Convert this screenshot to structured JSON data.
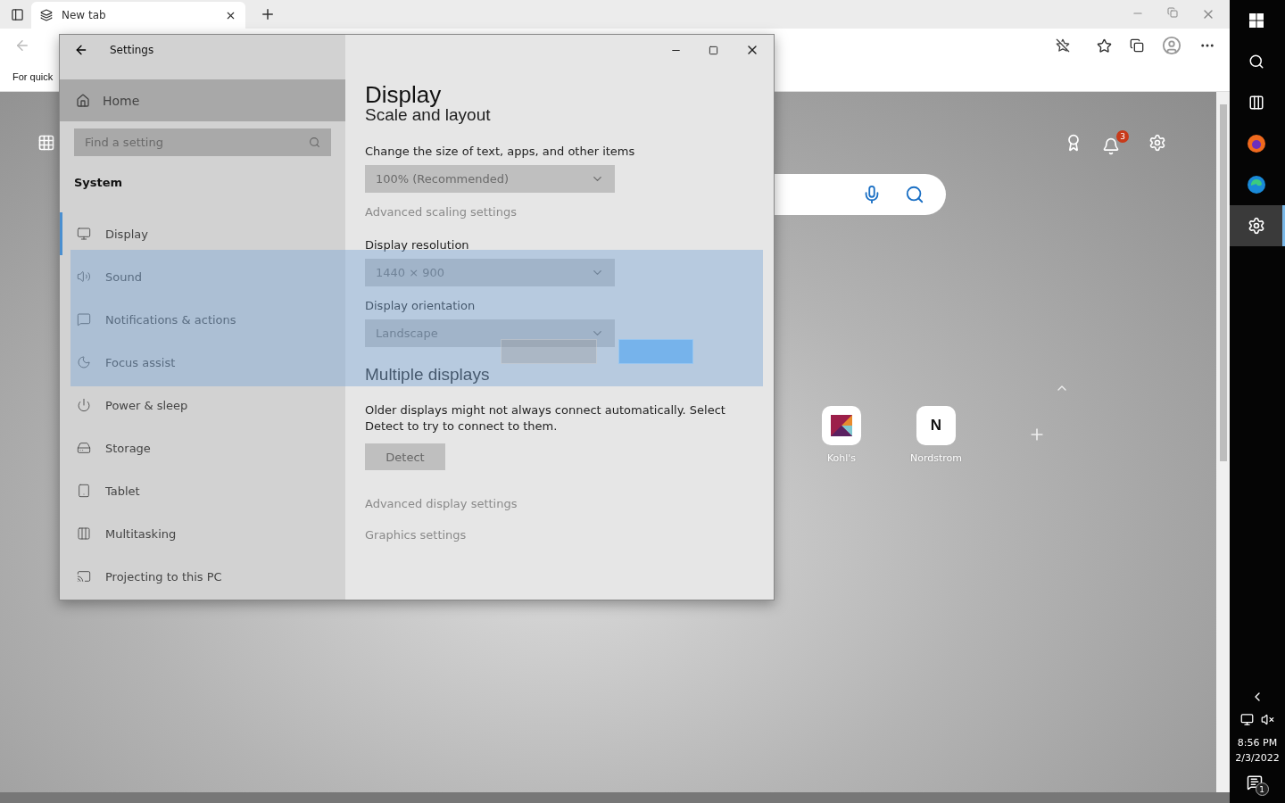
{
  "browser": {
    "tabs": [
      {
        "label": "New tab",
        "selected": true
      }
    ],
    "favorites_bar": {
      "text": "For quick"
    },
    "new_tab_page": {
      "notification_count": "3",
      "tiles": [
        {
          "kind": "logo",
          "label": "Kohl's"
        },
        {
          "kind": "letter",
          "letter": "N",
          "label": "Nordstrom"
        }
      ]
    }
  },
  "settings": {
    "title": "Settings",
    "home": "Home",
    "search": {
      "placeholder": "Find a setting"
    },
    "section": "System",
    "nav_items": [
      {
        "label": "Display",
        "selected": true
      },
      {
        "label": "Sound",
        "selected": false
      },
      {
        "label": "Notifications & actions",
        "selected": false
      },
      {
        "label": "Focus assist",
        "selected": false
      },
      {
        "label": "Power & sleep",
        "selected": false
      },
      {
        "label": "Storage",
        "selected": false
      },
      {
        "label": "Tablet",
        "selected": false
      },
      {
        "label": "Multitasking",
        "selected": false
      },
      {
        "label": "Projecting to this PC",
        "selected": false
      }
    ],
    "page_title": "Display",
    "scale_heading": "Scale and layout",
    "scale_label": "Change the size of text, apps, and other items",
    "scale_value": "100% (Recommended)",
    "scale_link": "Advanced scaling settings",
    "resolution_label": "Display resolution",
    "resolution_value": "1440 × 900",
    "orientation_label": "Display orientation",
    "orientation_value": "Landscape",
    "multiple_heading": "Multiple displays",
    "multiple_text": "Older displays might not always connect automatically. Select Detect to try to connect to them.",
    "detect_button": "Detect",
    "links": [
      "Advanced display settings",
      "Graphics settings"
    ]
  },
  "taskbar": {
    "apps": [
      {
        "kind": "firefox",
        "selected": false
      },
      {
        "kind": "edge",
        "selected": false
      },
      {
        "kind": "settings",
        "selected": true
      }
    ],
    "time": "8:56 PM",
    "date": "2/3/2022",
    "action_center_count": "1"
  }
}
